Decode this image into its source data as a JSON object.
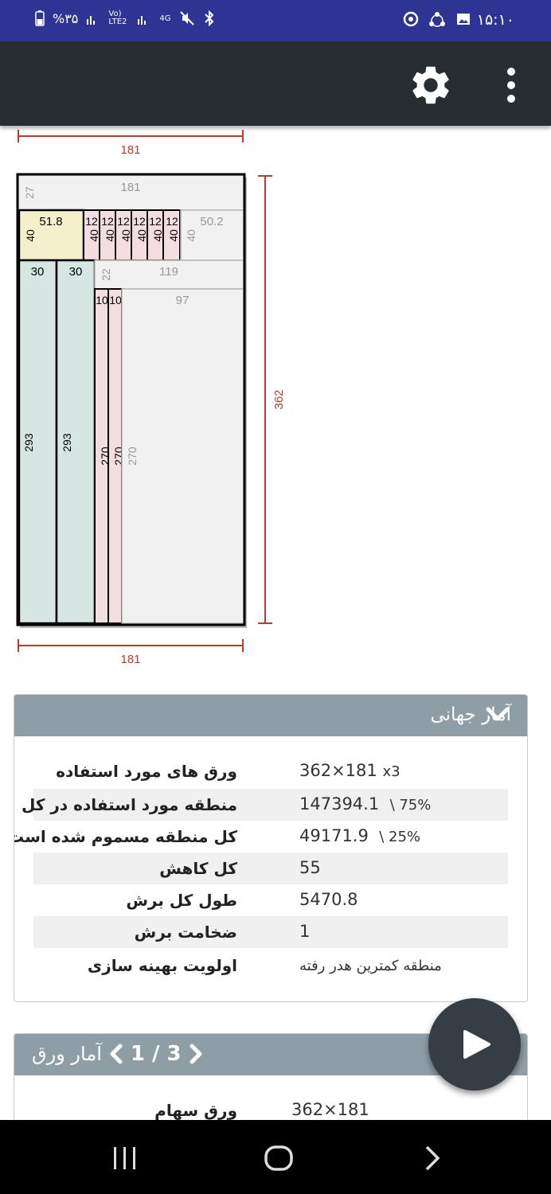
{
  "status_bar": {
    "time": "۱۵:۱۰",
    "battery": "%۳۵",
    "network": "4G",
    "volte": "Vo) LTE2"
  },
  "app_bar": {
    "settings_icon": "gear-icon",
    "menu_icon": "more-vert-icon"
  },
  "diagram": {
    "sheet_width_label": "181",
    "sheet_height_label": "362",
    "bottom_width_label": "181",
    "strip_top_width": "181",
    "strip_top_height": "27",
    "piece_a_width": "51.8",
    "piece_a_height": "40",
    "small_piece_width": "12",
    "small_piece_height": "40",
    "waste_a_width": "50.2",
    "waste_a_height": "40",
    "tall_piece_width": "30",
    "tall_piece_height": "293",
    "strip_mid_width": "119",
    "strip_mid_height": "22",
    "thin_piece_width": "10",
    "thin_piece_height": "270",
    "waste_b_width": "97",
    "waste_b_height": "270",
    "colors": {
      "frame": "#000000",
      "dimension": "#c0392b",
      "piece_yellow": "#f5f0cc",
      "piece_pink": "#f3dde0",
      "piece_teal": "#d6e7e3",
      "waste": "#f1f1f1",
      "waste_text": "#9a9a9a"
    }
  },
  "global_stats": {
    "title": "آمار جهانی",
    "rows": [
      {
        "label": "ورق های مورد استفاده",
        "value": "362×181",
        "extra": "x3"
      },
      {
        "label": "منطقه مورد استفاده در کل",
        "value": "147394.1",
        "extra": "\\ 75%"
      },
      {
        "label": "کل منطقه مسموم شده است",
        "value": "49171.9",
        "extra": "\\ 25%"
      },
      {
        "label": "کل کاهش",
        "value": "55",
        "extra": ""
      },
      {
        "label": "طول کل برش",
        "value": "5470.8",
        "extra": ""
      },
      {
        "label": "ضخامت برش",
        "value": "1",
        "extra": ""
      },
      {
        "label": "اولویت بهینه سازی",
        "value": "منطقه کمترین هدر رفته",
        "extra": ""
      }
    ]
  },
  "sheet_stats": {
    "title": "آمار ورق",
    "page": "1 / 3",
    "rows": [
      {
        "label": "ورق سهام",
        "value": "362×181"
      }
    ]
  },
  "fab": {
    "icon": "play-icon"
  },
  "nav": {
    "recents_icon": "recents-icon",
    "home_icon": "home-icon",
    "back_icon": "back-icon"
  }
}
